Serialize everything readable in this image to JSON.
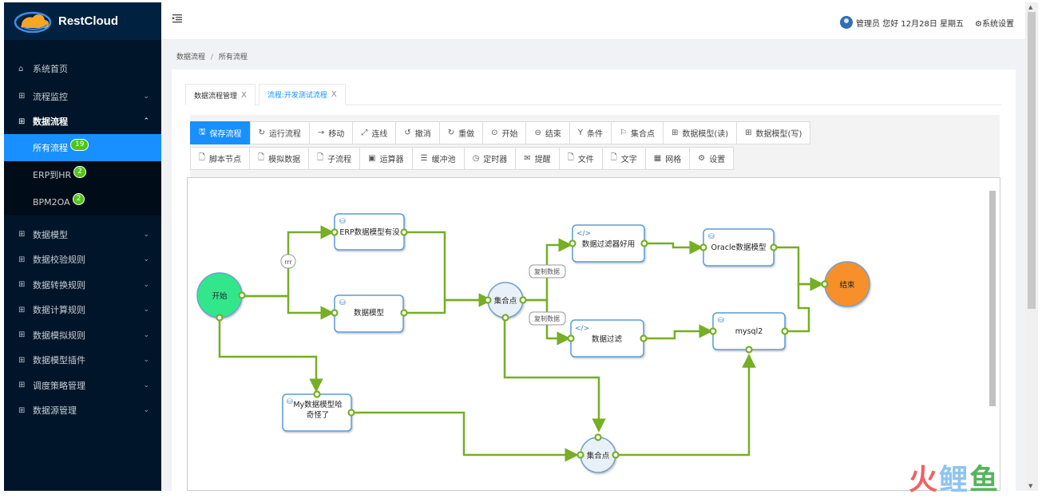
{
  "brand": {
    "name": "RestCloud"
  },
  "sidebar": {
    "home": "系统首页",
    "items": [
      {
        "label": "流程监控"
      },
      {
        "label": "数据流程"
      },
      {
        "label": "数据模型"
      },
      {
        "label": "数据校验规则"
      },
      {
        "label": "数据转换规则"
      },
      {
        "label": "数据计算规则"
      },
      {
        "label": "数据模拟规则"
      },
      {
        "label": "数据模型插件"
      },
      {
        "label": "调度策略管理"
      },
      {
        "label": "数据源管理"
      }
    ],
    "submenu": [
      {
        "label": "所有流程",
        "badge": "19"
      },
      {
        "label": "ERP到HR",
        "badge": "2"
      },
      {
        "label": "BPM2OA",
        "badge": "2"
      }
    ]
  },
  "header": {
    "greeting": "管理员 您好 12月28日 星期五",
    "settings": "系统设置"
  },
  "breadcrumb": {
    "parent": "数据流程",
    "separator": "/",
    "current": "所有流程"
  },
  "tabs": [
    {
      "label": "数据流程管理",
      "close": "X"
    },
    {
      "label": "流程:开发测试流程",
      "close": "X"
    }
  ],
  "toolbar": {
    "row1": [
      {
        "label": "保存流程",
        "icon": "save-icon"
      },
      {
        "label": "运行流程",
        "icon": "refresh-icon"
      },
      {
        "label": "移动",
        "icon": "arrow-right-icon"
      },
      {
        "label": "连线",
        "icon": "connect-icon"
      },
      {
        "label": "撤消",
        "icon": "undo-icon"
      },
      {
        "label": "重做",
        "icon": "redo-icon"
      },
      {
        "label": "开始",
        "icon": "play-icon"
      },
      {
        "label": "结束",
        "icon": "stop-icon"
      },
      {
        "label": "条件",
        "icon": "fork-icon"
      },
      {
        "label": "集合点",
        "icon": "flag-icon"
      },
      {
        "label": "数据模型(读)",
        "icon": "grid-icon"
      },
      {
        "label": "数据模型(写)",
        "icon": "grid-icon"
      }
    ],
    "row2": [
      {
        "label": "脚本节点",
        "icon": "file-icon"
      },
      {
        "label": "模拟数据",
        "icon": "file-icon"
      },
      {
        "label": "子流程",
        "icon": "file-icon"
      },
      {
        "label": "运算器",
        "icon": "calculator-icon"
      },
      {
        "label": "缓冲池",
        "icon": "buffer-icon"
      },
      {
        "label": "定时器",
        "icon": "clock-icon"
      },
      {
        "label": "提醒",
        "icon": "mail-icon"
      },
      {
        "label": "文件",
        "icon": "file-icon"
      },
      {
        "label": "文字",
        "icon": "file-icon"
      },
      {
        "label": "网格",
        "icon": "table-icon"
      },
      {
        "label": "设置",
        "icon": "gear-icon"
      }
    ]
  },
  "flow": {
    "nodes": {
      "start": "开始",
      "end": "结束",
      "erp_model": "ERP数据模型有没",
      "data_model": "数据模型",
      "merge1": "集合点",
      "filter_good": "数据过滤器好用",
      "filter": "数据过滤",
      "oracle": "Oracle数据模型",
      "mysql": "mysql2",
      "my_model_1": "My数据模型哈",
      "my_model_2": "奇怪了",
      "merge2": "集合点"
    },
    "edges": {
      "rr": "rrr",
      "copy1": "复制数据",
      "copy2": "复制数据"
    }
  },
  "watermark": {
    "c1": "火",
    "c2": "鲤",
    "c3": "鱼"
  },
  "colors": {
    "accent": "#1890ff",
    "sidebar": "#001529",
    "edge": "#76ae25",
    "start": "#33e68c",
    "end": "#f7902b",
    "badge": "#52c41a"
  }
}
